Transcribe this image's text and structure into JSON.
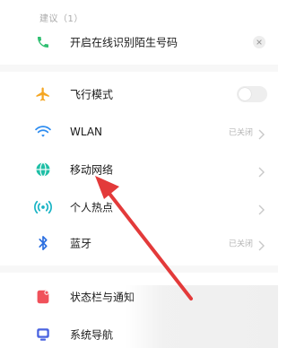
{
  "suggestions": {
    "header": "建议（1）",
    "item_label": "开启在线识别陌生号码"
  },
  "settings": {
    "airplane": {
      "label": "飞行模式",
      "icon": "airplane-icon"
    },
    "wlan": {
      "label": "WLAN",
      "status": "已关闭",
      "icon": "wifi-icon"
    },
    "mobile": {
      "label": "移动网络",
      "icon": "globe-icon"
    },
    "hotspot": {
      "label": "个人热点",
      "icon": "hotspot-icon"
    },
    "bluetooth": {
      "label": "蓝牙",
      "status": "已关闭",
      "icon": "bluetooth-icon"
    },
    "statusbar": {
      "label": "状态栏与通知",
      "icon": "notification-icon"
    },
    "nav": {
      "label": "系统导航",
      "icon": "navigation-icon"
    }
  },
  "colors": {
    "phone_green": "#2fbf71",
    "airplane_orange": "#f5a623",
    "wifi_blue": "#2d8cf0",
    "globe_teal": "#1fbfa6",
    "hotspot_teal": "#17b3c4",
    "bluetooth_blue": "#2b6fe0",
    "notify_red": "#f0515a",
    "nav_blue": "#4a63e0",
    "arrow_red": "#e33a3a"
  }
}
